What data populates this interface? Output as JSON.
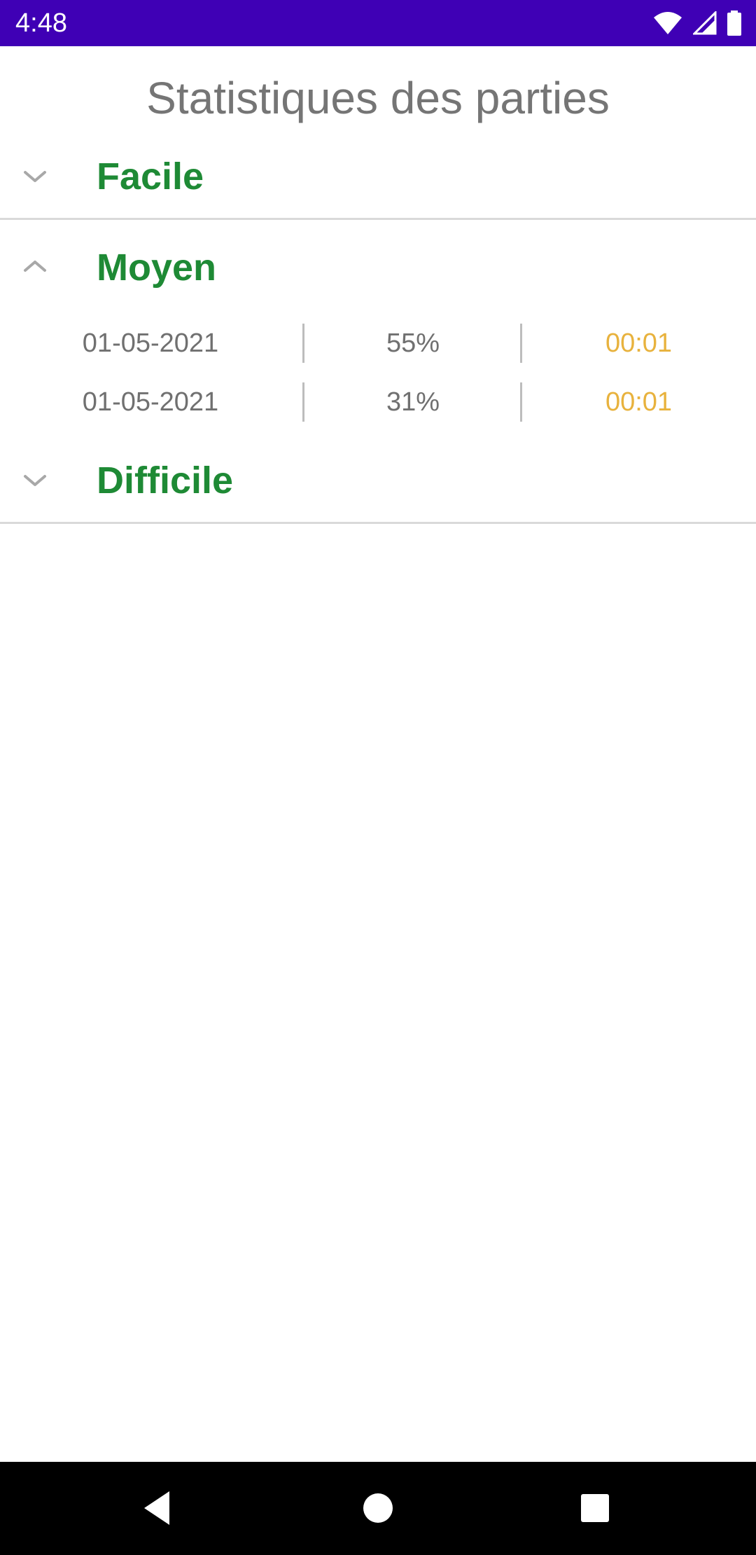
{
  "status_bar": {
    "time": "4:48",
    "icons": [
      "wifi-icon",
      "cellular-signal-icon",
      "battery-icon"
    ],
    "background_color": "#3f00b5"
  },
  "page": {
    "title": "Statistiques des parties"
  },
  "groups": [
    {
      "label": "Facile",
      "expanded": false,
      "rows": []
    },
    {
      "label": "Moyen",
      "expanded": true,
      "rows": [
        {
          "date": "01-05-2021",
          "percent": "55%",
          "time": "00:01"
        },
        {
          "date": "01-05-2021",
          "percent": "31%",
          "time": "00:01"
        }
      ]
    },
    {
      "label": "Difficile",
      "expanded": false,
      "rows": []
    }
  ],
  "colors": {
    "group_label": "#1e8a35",
    "time_value": "#e8b23d",
    "text_muted": "#707070"
  },
  "nav_bar": {
    "buttons": [
      "back-icon",
      "home-icon",
      "recents-icon"
    ]
  }
}
